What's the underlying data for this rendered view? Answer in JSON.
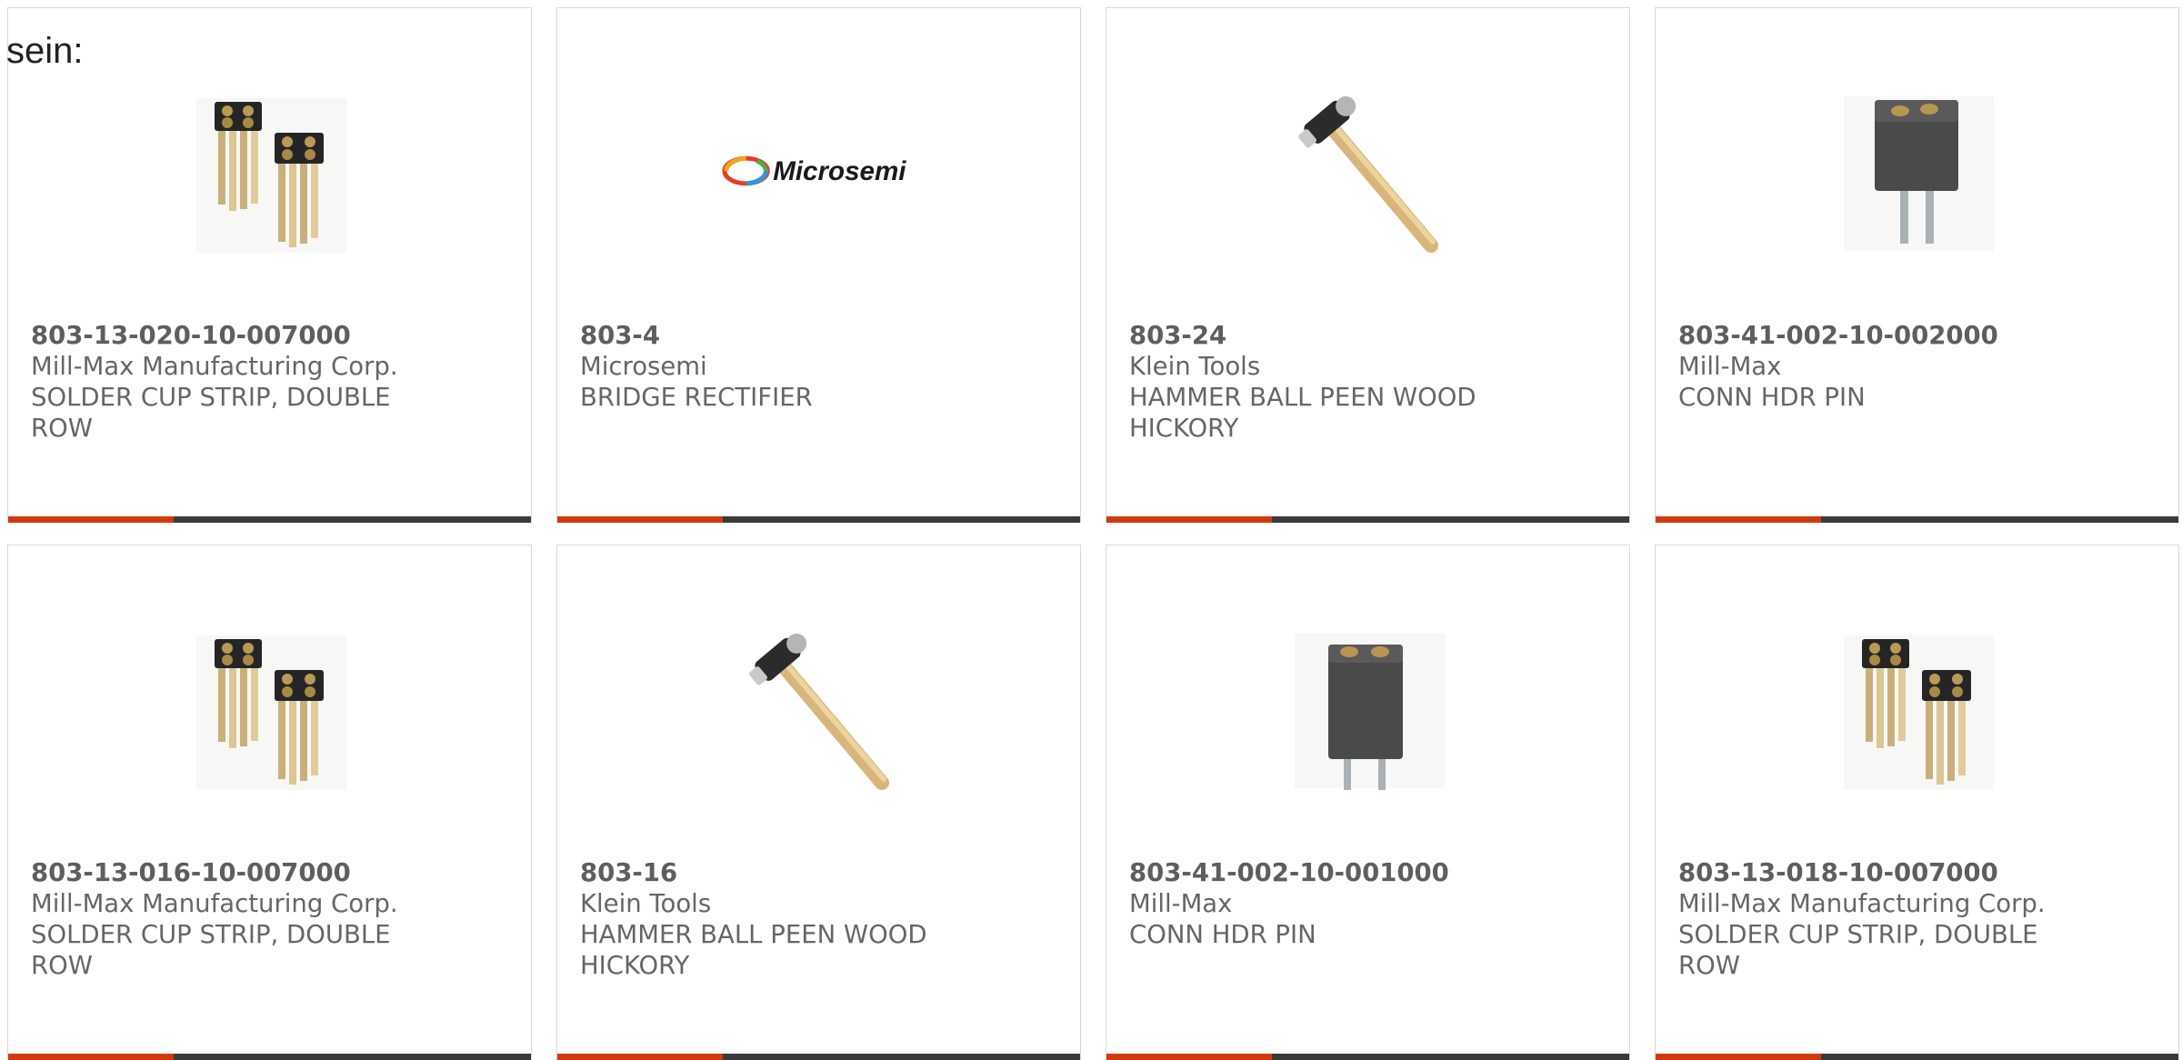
{
  "page": {
    "intro_text": "sein:"
  },
  "colors": {
    "accent": "#d03a0e",
    "bar": "#3a3a3a",
    "border": "#d9d9d9",
    "text": "#666666"
  },
  "products": [
    {
      "part_number": "803-13-020-10-007000",
      "manufacturer": "Mill-Max Manufacturing Corp.",
      "description": "SOLDER CUP STRIP, DOUBLE ROW",
      "image": "solder-cup-strip-image"
    },
    {
      "part_number": "803-4",
      "manufacturer": "Microsemi",
      "description": "BRIDGE RECTIFIER",
      "image": "microsemi-logo",
      "logo_text": "Microsemi"
    },
    {
      "part_number": "803-24",
      "manufacturer": "Klein Tools",
      "description": "HAMMER BALL PEEN WOOD HICKORY",
      "image": "ball-peen-hammer-image"
    },
    {
      "part_number": "803-41-002-10-002000",
      "manufacturer": "Mill-Max",
      "description": "CONN HDR PIN",
      "image": "header-pin-connector-image"
    },
    {
      "part_number": "803-13-016-10-007000",
      "manufacturer": "Mill-Max Manufacturing Corp.",
      "description": "SOLDER CUP STRIP, DOUBLE ROW",
      "image": "solder-cup-strip-image"
    },
    {
      "part_number": "803-16",
      "manufacturer": "Klein Tools",
      "description": "HAMMER BALL PEEN WOOD HICKORY",
      "image": "ball-peen-hammer-image"
    },
    {
      "part_number": "803-41-002-10-001000",
      "manufacturer": "Mill-Max",
      "description": "CONN HDR PIN",
      "image": "header-pin-connector-image"
    },
    {
      "part_number": "803-13-018-10-007000",
      "manufacturer": "Mill-Max Manufacturing Corp.",
      "description": "SOLDER CUP STRIP, DOUBLE ROW",
      "image": "solder-cup-strip-image"
    }
  ]
}
